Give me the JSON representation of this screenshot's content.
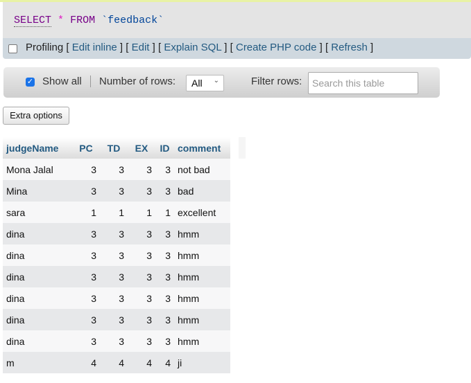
{
  "query": {
    "keyword_select": "SELECT",
    "operator": "*",
    "keyword_from": "FROM",
    "table": "`feedback`"
  },
  "toolbar": {
    "profiling_label": "Profiling",
    "profiling_checked": false,
    "links": [
      "Edit inline",
      "Edit",
      "Explain SQL",
      "Create PHP code",
      "Refresh"
    ]
  },
  "navigation": {
    "show_all_label": "Show all",
    "show_all_checked": true,
    "rows_label": "Number of rows:",
    "rows_value": "All",
    "filter_label": "Filter rows:",
    "filter_placeholder": "Search this table"
  },
  "extra_options_label": "Extra options",
  "table": {
    "columns": [
      "judgeName",
      "PC",
      "TD",
      "EX",
      "ID",
      "comment"
    ],
    "rows": [
      [
        "Mona Jalal",
        "3",
        "3",
        "3",
        "3",
        "not bad"
      ],
      [
        "Mina",
        "3",
        "3",
        "3",
        "3",
        "bad"
      ],
      [
        "sara",
        "1",
        "1",
        "1",
        "1",
        "excellent"
      ],
      [
        "dina",
        "3",
        "3",
        "3",
        "3",
        "hmm"
      ],
      [
        "dina",
        "3",
        "3",
        "3",
        "3",
        "hmm"
      ],
      [
        "dina",
        "3",
        "3",
        "3",
        "3",
        "hmm"
      ],
      [
        "dina",
        "3",
        "3",
        "3",
        "3",
        "hmm"
      ],
      [
        "dina",
        "3",
        "3",
        "3",
        "3",
        "hmm"
      ],
      [
        "dina",
        "3",
        "3",
        "3",
        "3",
        "hmm"
      ],
      [
        "m",
        "4",
        "4",
        "4",
        "4",
        "ji"
      ]
    ]
  }
}
